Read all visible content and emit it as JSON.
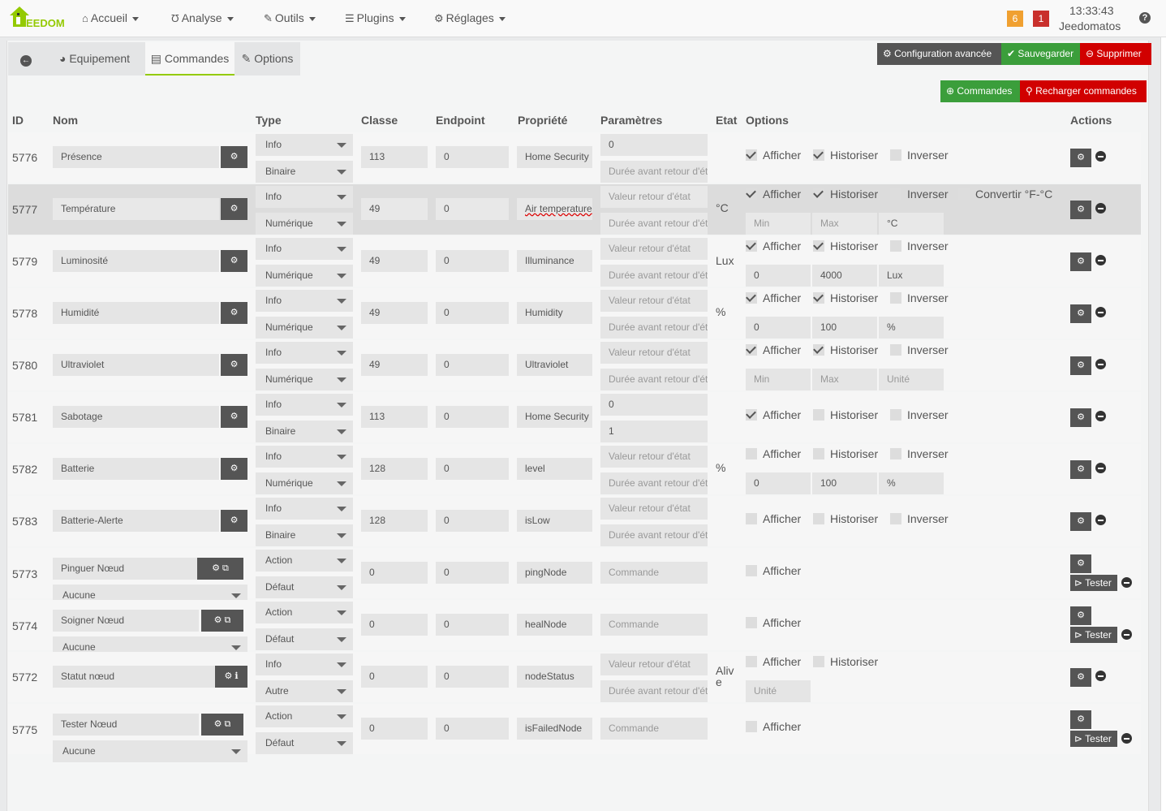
{
  "brand": {
    "logo_text": "EEDOM",
    "colors": {
      "accent": "#94ca02",
      "dark_btn": "#555555",
      "green": "#3b9e3b",
      "red": "#d10000",
      "badge_orange": "#f0a030",
      "badge_red": "#c9302c"
    }
  },
  "nav": {
    "items": [
      {
        "label": "Accueil",
        "icon": "home-icon"
      },
      {
        "label": "Analyse",
        "icon": "stethoscope-icon"
      },
      {
        "label": "Outils",
        "icon": "wrench-icon"
      },
      {
        "label": "Plugins",
        "icon": "list-icon"
      },
      {
        "label": "Réglages",
        "icon": "gear-icon"
      }
    ],
    "badges": {
      "warning": "6",
      "alert": "1"
    },
    "time": "13:33:43",
    "user": "Jeedomatos",
    "help": "?"
  },
  "tabs": {
    "back": "back-icon",
    "equipment": "Equipement",
    "commands": "Commandes",
    "options": "Options"
  },
  "toolbar": {
    "config": "Configuration avancée",
    "save": "Sauvegarder",
    "delete": "Supprimer",
    "add_commands": "Commandes",
    "reload": "Recharger commandes"
  },
  "columns": {
    "id": "ID",
    "name": "Nom",
    "type": "Type",
    "class": "Classe",
    "endpoint": "Endpoint",
    "property": "Propriété",
    "params": "Paramètres",
    "state": "Etat",
    "options": "Options",
    "actions": "Actions"
  },
  "labels": {
    "afficher": "Afficher",
    "historiser": "Historiser",
    "inverser": "Inverser",
    "convertir": "Convertir °F-°C",
    "tester": "Tester",
    "valeur_retour": "Valeur retour d'état",
    "duree_retour": "Durée avant retour d'état",
    "commande": "Commande",
    "min": "Min",
    "max": "Max",
    "unite": "Unité"
  },
  "rows": [
    {
      "id": "5776",
      "name": "Présence",
      "type": "Info",
      "subtype": "Binaire",
      "classe": "113",
      "endpoint": "0",
      "prop": "Home Security",
      "param1": "0",
      "param2": "",
      "unit": "",
      "afficher": true,
      "historiser": true,
      "inverser": false
    },
    {
      "id": "5777",
      "name": "Température",
      "type": "Info",
      "subtype": "Numérique",
      "classe": "49",
      "endpoint": "0",
      "prop": "Air temperature",
      "unit": "°C",
      "afficher": true,
      "historiser": true,
      "inverser": false,
      "convertir": false,
      "min": "",
      "max": "",
      "unite_val": "°C"
    },
    {
      "id": "5779",
      "name": "Luminosité",
      "type": "Info",
      "subtype": "Numérique",
      "classe": "49",
      "endpoint": "0",
      "prop": "Illuminance",
      "unit": "Lux",
      "afficher": true,
      "historiser": true,
      "inverser": false,
      "min": "0",
      "max": "4000",
      "unite_val": "Lux"
    },
    {
      "id": "5778",
      "name": "Humidité",
      "type": "Info",
      "subtype": "Numérique",
      "classe": "49",
      "endpoint": "0",
      "prop": "Humidity",
      "unit": "%",
      "afficher": true,
      "historiser": true,
      "inverser": false,
      "min": "0",
      "max": "100",
      "unite_val": "%"
    },
    {
      "id": "5780",
      "name": "Ultraviolet",
      "type": "Info",
      "subtype": "Numérique",
      "classe": "49",
      "endpoint": "0",
      "prop": "Ultraviolet",
      "unit": "",
      "afficher": true,
      "historiser": true,
      "inverser": false,
      "min": "",
      "max": "",
      "unite_val": ""
    },
    {
      "id": "5781",
      "name": "Sabotage",
      "type": "Info",
      "subtype": "Binaire",
      "classe": "113",
      "endpoint": "0",
      "prop": "Home Security",
      "param1": "0",
      "param2": "1",
      "unit": "",
      "afficher": true,
      "historiser": false,
      "inverser": false
    },
    {
      "id": "5782",
      "name": "Batterie",
      "type": "Info",
      "subtype": "Numérique",
      "classe": "128",
      "endpoint": "0",
      "prop": "level",
      "unit": "%",
      "afficher": false,
      "historiser": false,
      "inverser": false,
      "min": "0",
      "max": "100",
      "unite_val": "%"
    },
    {
      "id": "5783",
      "name": "Batterie-Alerte",
      "type": "Info",
      "subtype": "Binaire",
      "classe": "128",
      "endpoint": "0",
      "prop": "isLow",
      "unit": "",
      "afficher": false,
      "historiser": false,
      "inverser": false
    },
    {
      "id": "5773",
      "name": "Pinguer Nœud",
      "linked": "Aucune",
      "type": "Action",
      "subtype": "Défaut",
      "classe": "0",
      "endpoint": "0",
      "prop": "pingNode",
      "afficher": false
    },
    {
      "id": "5774",
      "name": "Soigner Nœud",
      "linked": "Aucune",
      "type": "Action",
      "subtype": "Défaut",
      "classe": "0",
      "endpoint": "0",
      "prop": "healNode",
      "afficher": false
    },
    {
      "id": "5772",
      "name": "Statut nœud",
      "type": "Info",
      "subtype": "Autre",
      "classe": "0",
      "endpoint": "0",
      "prop": "nodeStatus",
      "unit": "Aliv\ne",
      "afficher": false,
      "historiser": false,
      "unite_val": ""
    },
    {
      "id": "5775",
      "name": "Tester Nœud",
      "linked": "Aucune",
      "type": "Action",
      "subtype": "Défaut",
      "classe": "0",
      "endpoint": "0",
      "prop": "isFailedNode",
      "afficher": false
    }
  ]
}
